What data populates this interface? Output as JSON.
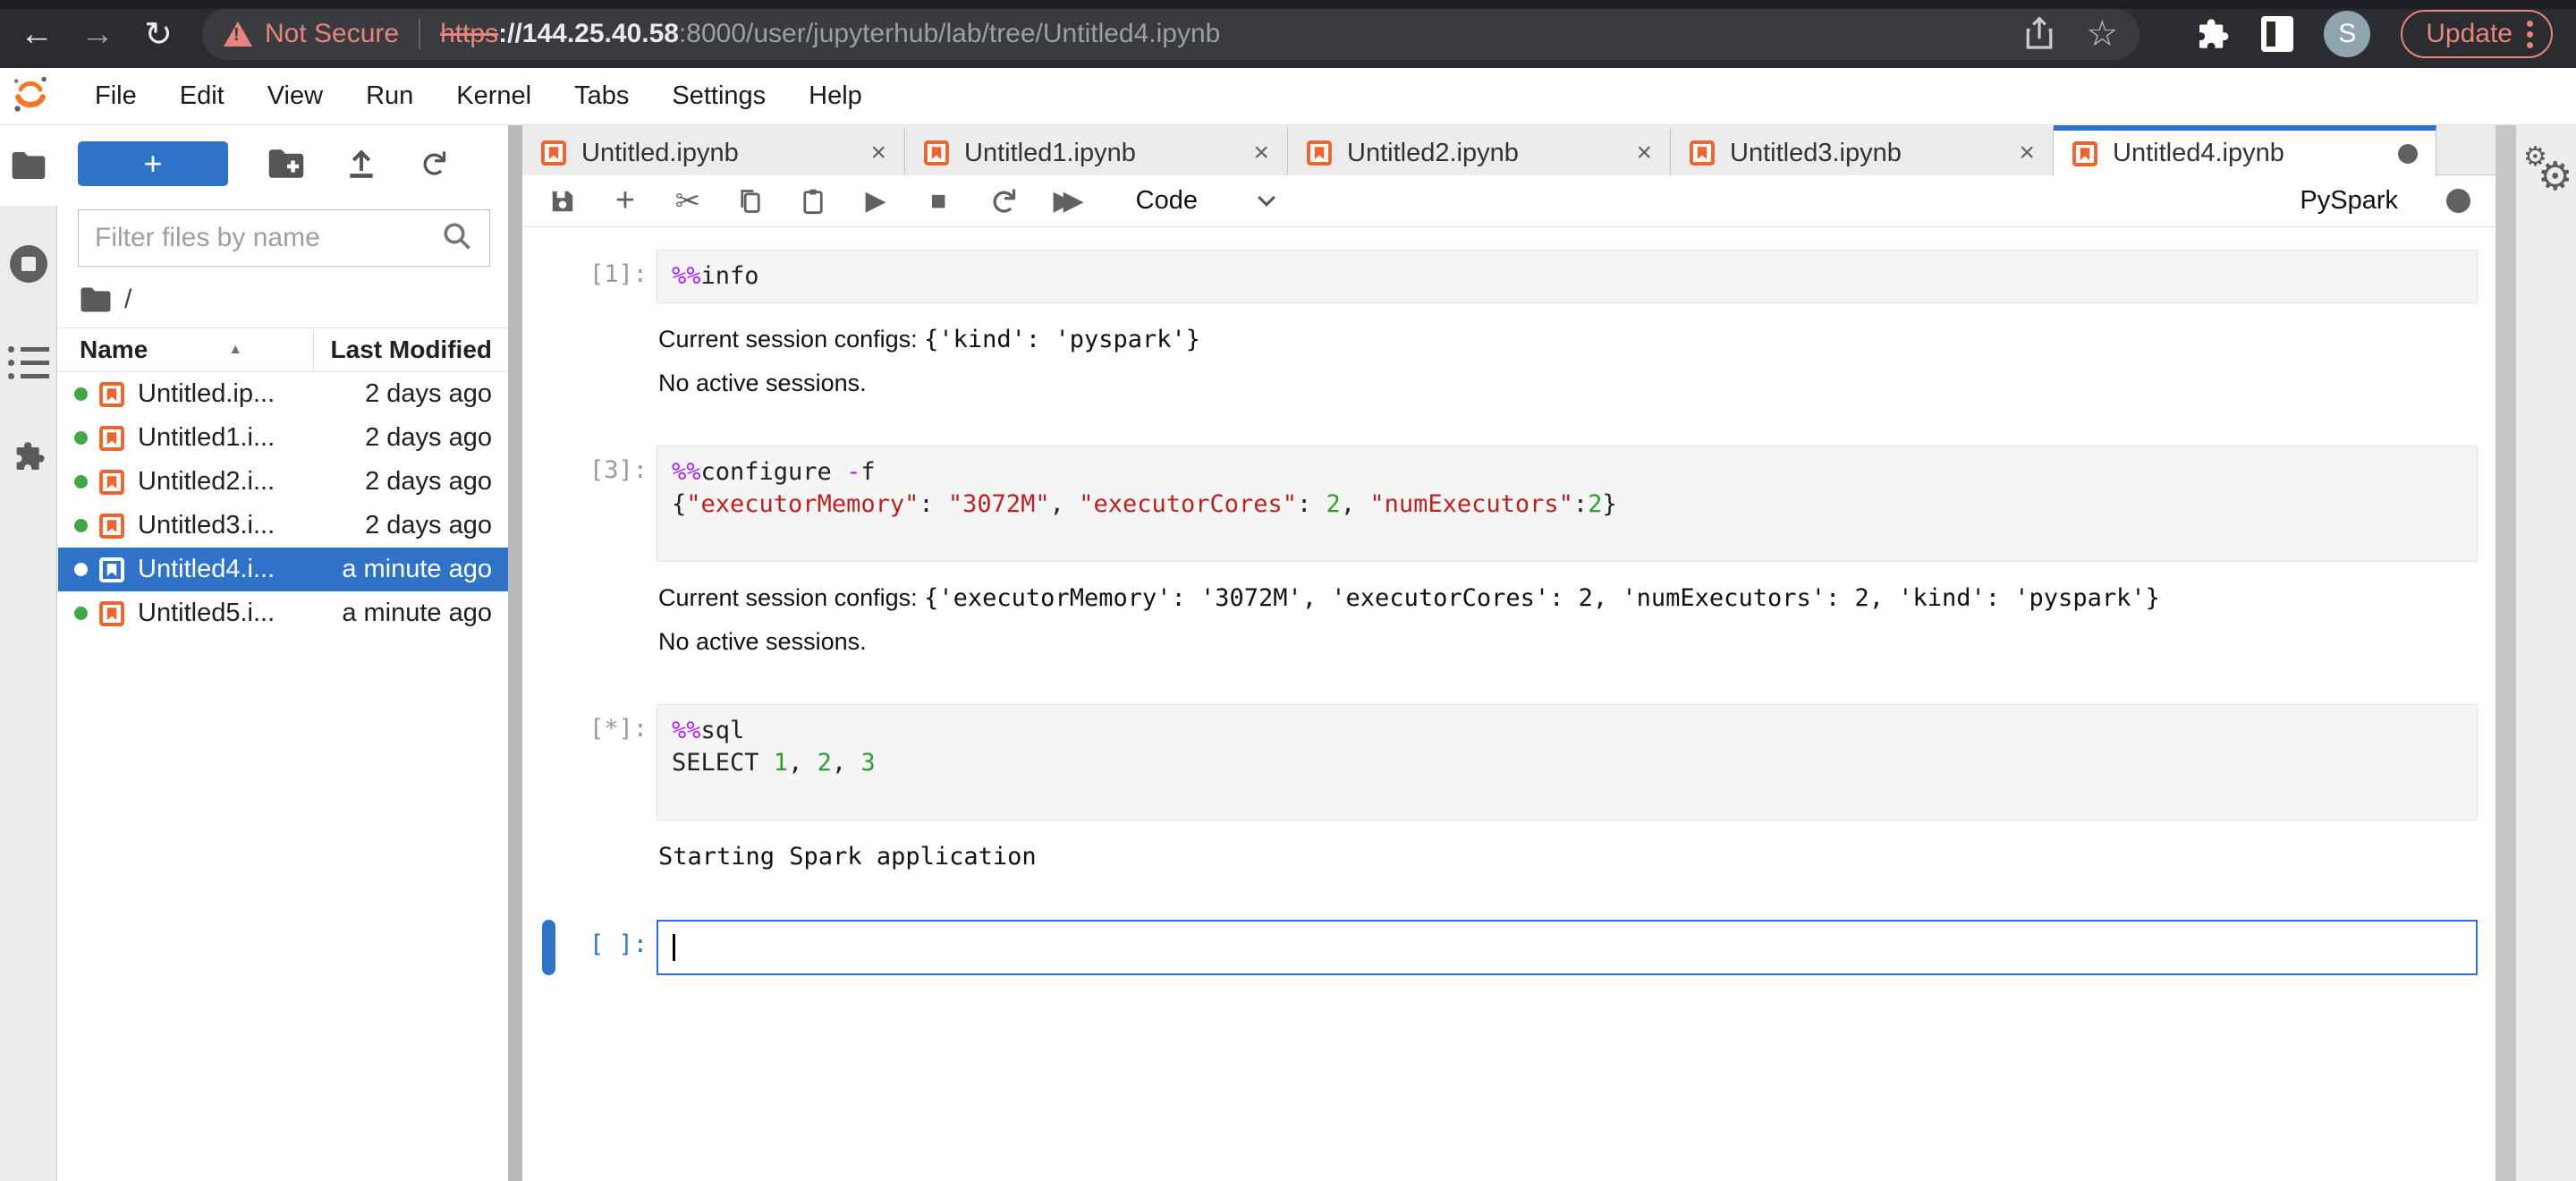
{
  "colors": {
    "accent": "#2f73c8",
    "notebook_orange": "#ec6430",
    "salmon": "#e8847e",
    "magic": "#aa22ff",
    "string": "#ba2121",
    "number": "#2e9e2e",
    "running_green": "#3fa745"
  },
  "browser": {
    "not_secure_label": "Not Secure",
    "url_scheme": "https",
    "url_host": "://144.25.40.58",
    "url_path": ":8000/user/jupyterhub/lab/tree/Untitled4.ipynb",
    "avatar_initial": "S",
    "update_label": "Update"
  },
  "menubar": {
    "items": [
      "File",
      "Edit",
      "View",
      "Run",
      "Kernel",
      "Tabs",
      "Settings",
      "Help"
    ]
  },
  "file_browser": {
    "new_launcher_label": "+",
    "filter_placeholder": "Filter files by name",
    "breadcrumb": "/",
    "columns": {
      "name": "Name",
      "modified": "Last Modified"
    },
    "sort_caret": "▲",
    "files": [
      {
        "name": "Untitled.ip...",
        "modified": "2 days ago",
        "selected": false,
        "running": true
      },
      {
        "name": "Untitled1.i...",
        "modified": "2 days ago",
        "selected": false,
        "running": true
      },
      {
        "name": "Untitled2.i...",
        "modified": "2 days ago",
        "selected": false,
        "running": true
      },
      {
        "name": "Untitled3.i...",
        "modified": "2 days ago",
        "selected": false,
        "running": true
      },
      {
        "name": "Untitled4.i...",
        "modified": "a minute ago",
        "selected": true,
        "running": true
      },
      {
        "name": "Untitled5.i...",
        "modified": "a minute ago",
        "selected": false,
        "running": true
      }
    ]
  },
  "tabs": [
    {
      "label": "Untitled.ipynb",
      "active": false,
      "dirty": false
    },
    {
      "label": "Untitled1.ipynb",
      "active": false,
      "dirty": false
    },
    {
      "label": "Untitled2.ipynb",
      "active": false,
      "dirty": false
    },
    {
      "label": "Untitled3.ipynb",
      "active": false,
      "dirty": false
    },
    {
      "label": "Untitled4.ipynb",
      "active": true,
      "dirty": true
    }
  ],
  "notebook_toolbar": {
    "cell_type": "Code",
    "kernel_name": "PySpark"
  },
  "cells": [
    {
      "prompt": "[1]:",
      "active": false,
      "pad_lines": 0,
      "code": [
        [
          [
            "mg",
            "%%"
          ],
          [
            "tx",
            "info"
          ]
        ]
      ],
      "outputs": [
        {
          "type": "mixed",
          "plain": "Current session configs: ",
          "mono": "{'kind': 'pyspark'}"
        },
        {
          "type": "plain",
          "text": "No active sessions."
        }
      ]
    },
    {
      "prompt": "[3]:",
      "active": false,
      "pad_lines": 1,
      "code": [
        [
          [
            "mg",
            "%%"
          ],
          [
            "tx",
            "configure "
          ],
          [
            "mg",
            "-"
          ],
          [
            "tx",
            "f"
          ]
        ],
        [
          [
            "tx",
            "{"
          ],
          [
            "st",
            "\"executorMemory\""
          ],
          [
            "tx",
            ": "
          ],
          [
            "st",
            "\"3072M\""
          ],
          [
            "tx",
            ", "
          ],
          [
            "st",
            "\"executorCores\""
          ],
          [
            "tx",
            ": "
          ],
          [
            "nm",
            "2"
          ],
          [
            "tx",
            ", "
          ],
          [
            "st",
            "\"numExecutors\""
          ],
          [
            "tx",
            ":"
          ],
          [
            "nm",
            "2"
          ],
          [
            "tx",
            "}"
          ]
        ]
      ],
      "outputs": [
        {
          "type": "mixed",
          "plain": "Current session configs: ",
          "mono": "{'executorMemory': '3072M', 'executorCores': 2, 'numExecutors': 2, 'kind': 'pyspark'}"
        },
        {
          "type": "plain",
          "text": "No active sessions."
        }
      ]
    },
    {
      "prompt": "[*]:",
      "active": false,
      "pad_lines": 1,
      "code": [
        [
          [
            "mg",
            "%%"
          ],
          [
            "tx",
            "sql"
          ]
        ],
        [
          [
            "kw",
            "SELECT "
          ],
          [
            "nm",
            "1"
          ],
          [
            "tx",
            ", "
          ],
          [
            "nm",
            "2"
          ],
          [
            "tx",
            ", "
          ],
          [
            "nm",
            "3"
          ]
        ]
      ],
      "outputs": [
        {
          "type": "mono",
          "text": "Starting Spark application"
        }
      ]
    },
    {
      "prompt": "[ ]:",
      "active": true,
      "pad_lines": 0,
      "code": [],
      "outputs": []
    }
  ]
}
